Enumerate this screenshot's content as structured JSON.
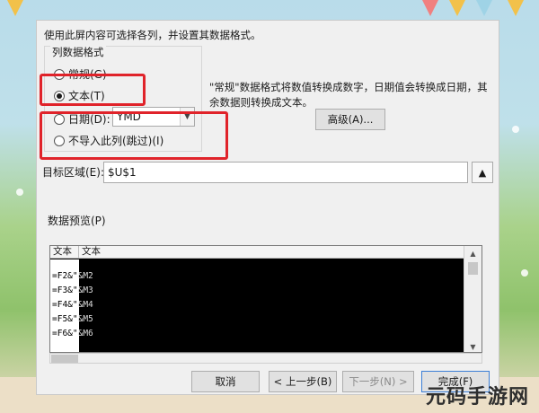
{
  "dialog": {
    "instruction": "使用此屏内容可选择各列，并设置其数据格式。",
    "format_group": {
      "title": "列数据格式",
      "options": [
        {
          "label": "常规(G)",
          "selected": false
        },
        {
          "label": "文本(T)",
          "selected": true
        },
        {
          "label": "日期(D):",
          "selected": false
        },
        {
          "label": "不导入此列(跳过)(I)",
          "selected": false
        }
      ],
      "date_format": "YMD"
    },
    "description": "\"常规\"数据格式将数值转换成数字，日期值会转换成日期，其余数据则转换成文本。",
    "advanced_button": "高级(A)...",
    "target": {
      "label": "目标区域(E):",
      "value": "$U$1"
    },
    "preview": {
      "label": "数据预览(P)",
      "headers": [
        "文本",
        "文本"
      ],
      "rows": [
        [
          "=F2&\"",
          "&M2"
        ],
        [
          "=F3&\"",
          "&M3"
        ],
        [
          "=F4&\"",
          "&M4"
        ],
        [
          "=F5&\"",
          "&M5"
        ],
        [
          "=F6&\"",
          "&M6"
        ]
      ]
    },
    "buttons": {
      "cancel": "取消",
      "back": "< 上一步(B)",
      "next": "下一步(N) >",
      "finish": "完成(F)"
    }
  },
  "watermark": "元码手游网",
  "colors": {
    "highlight": "#e0232a",
    "preview_bg": "#000000"
  }
}
